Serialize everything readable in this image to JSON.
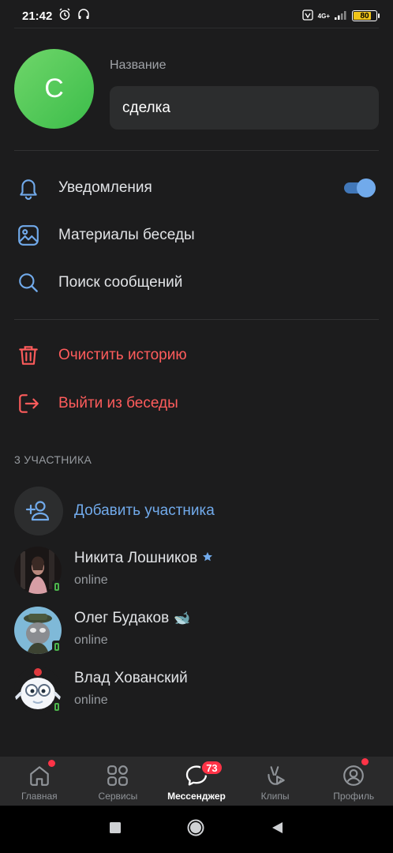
{
  "status_bar": {
    "time": "21:42",
    "network": "4G+",
    "battery": "80"
  },
  "header": {
    "avatar_letter": "С",
    "name_label": "Название",
    "name_value": "сделка"
  },
  "menu": [
    {
      "label": "Уведомления",
      "icon": "bell-icon",
      "toggle_on": true
    },
    {
      "label": "Материалы беседы",
      "icon": "image-icon"
    },
    {
      "label": "Поиск сообщений",
      "icon": "search-icon"
    }
  ],
  "danger_menu": [
    {
      "label": "Очистить историю",
      "icon": "trash-icon"
    },
    {
      "label": "Выйти из беседы",
      "icon": "logout-icon"
    }
  ],
  "members_section": {
    "title": "3 УЧАСТНИКА",
    "add_label": "Добавить участника",
    "members": [
      {
        "name": "Никита Лошников",
        "status": "online",
        "badge": "star-icon"
      },
      {
        "name": "Олег Будаков",
        "status": "online",
        "badge": "whale-emoji",
        "emoji": "🐋"
      },
      {
        "name": "Влад Хованский",
        "status": "online"
      }
    ]
  },
  "tabbar": {
    "tabs": [
      {
        "label": "Главная",
        "icon": "home-icon",
        "dot": true
      },
      {
        "label": "Сервисы",
        "icon": "services-icon"
      },
      {
        "label": "Мессенджер",
        "icon": "messenger-icon",
        "active": true,
        "badge": "73"
      },
      {
        "label": "Клипы",
        "icon": "clips-icon"
      },
      {
        "label": "Профиль",
        "icon": "profile-icon",
        "dot": true
      }
    ]
  },
  "colors": {
    "accent": "#71aaeb",
    "danger": "#ff5c5c",
    "background": "#1c1c1d",
    "online": "#4bb34b"
  }
}
